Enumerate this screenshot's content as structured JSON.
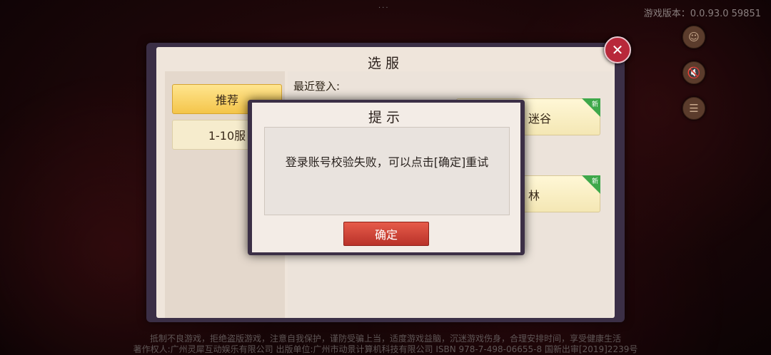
{
  "top": {
    "dots": "···",
    "version": "游戏版本：0.0.93.0 59851"
  },
  "side_buttons": [
    {
      "icon": "character-icon"
    },
    {
      "icon": "speaker-mute-icon"
    },
    {
      "icon": "notice-icon"
    }
  ],
  "server_panel": {
    "title": "选服",
    "tabs": [
      {
        "label": "推荐",
        "active": true
      },
      {
        "label": "1-10服",
        "active": false
      }
    ],
    "recent_label": "最近登入:",
    "servers": [
      {
        "name_fragment": "迷谷",
        "tag": "新"
      },
      {
        "name_fragment": "林",
        "tag": "新"
      }
    ]
  },
  "dialog": {
    "title": "提示",
    "message": "登录账号校验失败，可以点击[确定]重试",
    "confirm_label": "确定"
  },
  "footer": {
    "line1": "抵制不良游戏，拒绝盗版游戏，注意自我保护，谨防受骗上当，适度游戏益脑，沉迷游戏伤身，合理安排时间，享受健康生活",
    "line2": "著作权人:广州灵犀互动娱乐有限公司  出版单位:广州市动景计算机科技有限公司  ISBN 978-7-498-06655-8  国新出审[2019]2239号"
  }
}
